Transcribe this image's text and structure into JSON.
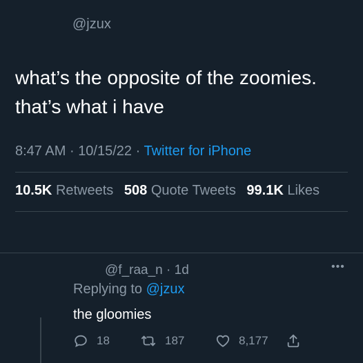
{
  "tweet": {
    "handle": "@jzux",
    "text_line1": "what’s the opposite of the zoomies.",
    "text_line2": "that’s what i have",
    "time": "8:47 AM",
    "date": "10/15/22",
    "separator": "·",
    "source": "Twitter for iPhone",
    "stats": {
      "retweets_count": "10.5K",
      "retweets_label": "Retweets",
      "quotes_count": "508",
      "quotes_label": "Quote Tweets",
      "likes_count": "99.1K",
      "likes_label": "Likes"
    }
  },
  "reply": {
    "handle": "@f_raa_n",
    "separator": "·",
    "age": "1d",
    "more": "•••",
    "replying_prefix": "Replying to",
    "replying_to": "@jzux",
    "text": "the gloomies",
    "actions": {
      "reply_count": "18",
      "retweet_count": "187",
      "like_count": "8,177"
    }
  },
  "colors": {
    "background": "#15202b",
    "muted": "#8b98a5",
    "accent": "#1d9bf0",
    "divider": "#38444d"
  }
}
